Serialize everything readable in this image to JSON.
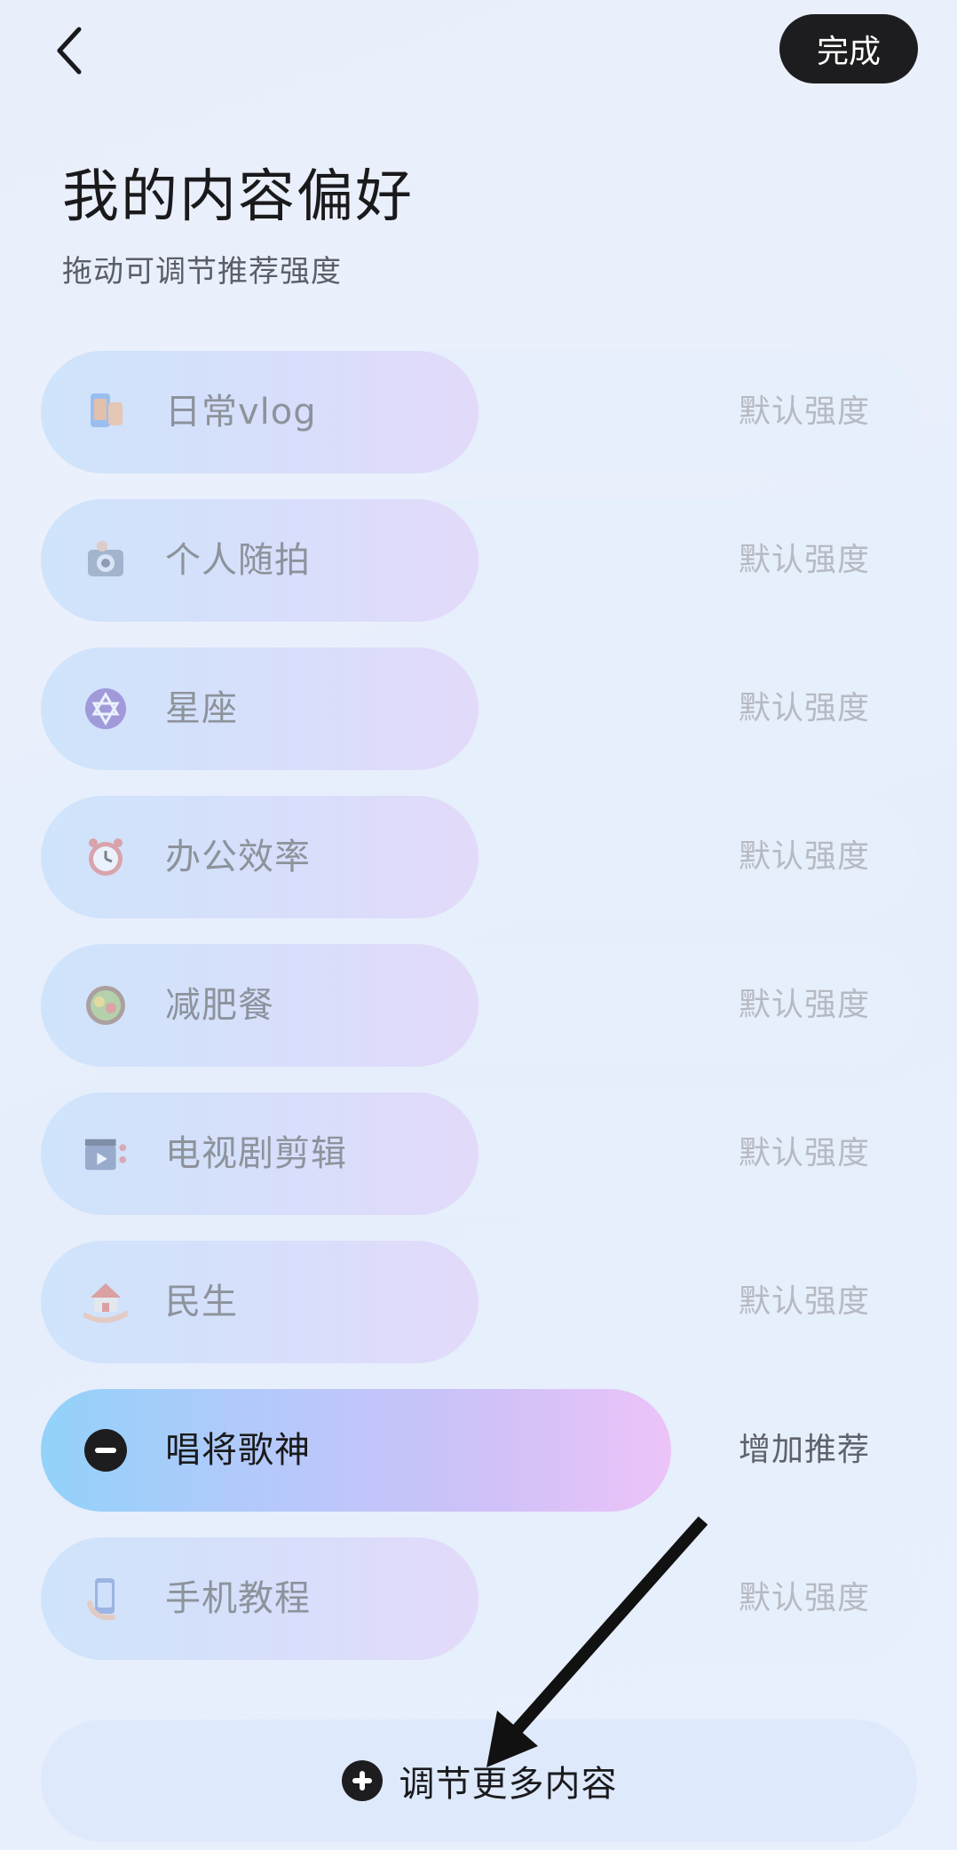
{
  "header": {
    "done_label": "完成"
  },
  "page": {
    "title": "我的内容偏好",
    "subtitle": "拖动可调节推荐强度"
  },
  "preferences": [
    {
      "label": "日常vlog",
      "strength": "默认强度",
      "icon": "phone-vlog-icon",
      "active": false
    },
    {
      "label": "个人随拍",
      "strength": "默认强度",
      "icon": "camera-icon",
      "active": false
    },
    {
      "label": "星座",
      "strength": "默认强度",
      "icon": "star-of-david-icon",
      "active": false
    },
    {
      "label": "办公效率",
      "strength": "默认强度",
      "icon": "alarm-clock-icon",
      "active": false
    },
    {
      "label": "减肥餐",
      "strength": "默认强度",
      "icon": "salad-bowl-icon",
      "active": false
    },
    {
      "label": "电视剧剪辑",
      "strength": "默认强度",
      "icon": "clapperboard-icon",
      "active": false
    },
    {
      "label": "民生",
      "strength": "默认强度",
      "icon": "house-hand-icon",
      "active": false
    },
    {
      "label": "唱将歌神",
      "strength": "增加推荐",
      "icon": "minus-circle-icon",
      "active": true
    },
    {
      "label": "手机教程",
      "strength": "默认强度",
      "icon": "phone-hand-icon",
      "active": false
    }
  ],
  "more": {
    "label": "调节更多内容",
    "icon": "plus-circle-icon"
  },
  "colors": {
    "accent_dark": "#1d1d1f",
    "active_start": "#92d2fa",
    "active_end": "#ecc3f8"
  }
}
